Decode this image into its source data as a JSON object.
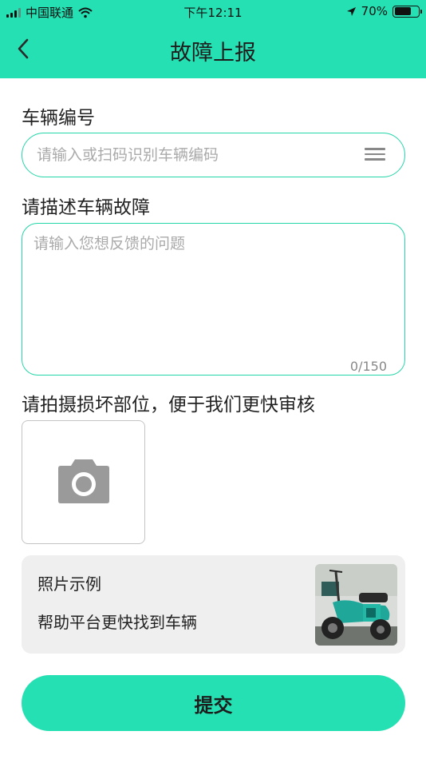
{
  "status_bar": {
    "carrier": "中国联通",
    "time": "下午12:11",
    "battery": "70%",
    "battery_level": 0.7,
    "icons": [
      "signal-icon",
      "wifi-icon",
      "location-arrow-icon",
      "battery-icon"
    ]
  },
  "header": {
    "title": "故障上报",
    "back_icon": "chevron-left-icon"
  },
  "vehicle_number": {
    "label": "车辆编号",
    "placeholder": "请输入或扫码识别车辆编码",
    "value": "",
    "scan_icon": "scan-menu-icon"
  },
  "fault_description": {
    "label": "请描述车辆故障",
    "placeholder": "请输入您想反馈的问题",
    "value": "",
    "counter": "0/150"
  },
  "photo": {
    "label": "请拍摄损坏部位，便于我们更快审核",
    "icon": "camera-icon"
  },
  "example": {
    "title": "照片示例",
    "description": "帮助平台更快找到车辆"
  },
  "submit_label": "提交",
  "colors": {
    "accent": "#25e0b2",
    "border": "#25d6a8",
    "card_bg": "#efefef"
  }
}
